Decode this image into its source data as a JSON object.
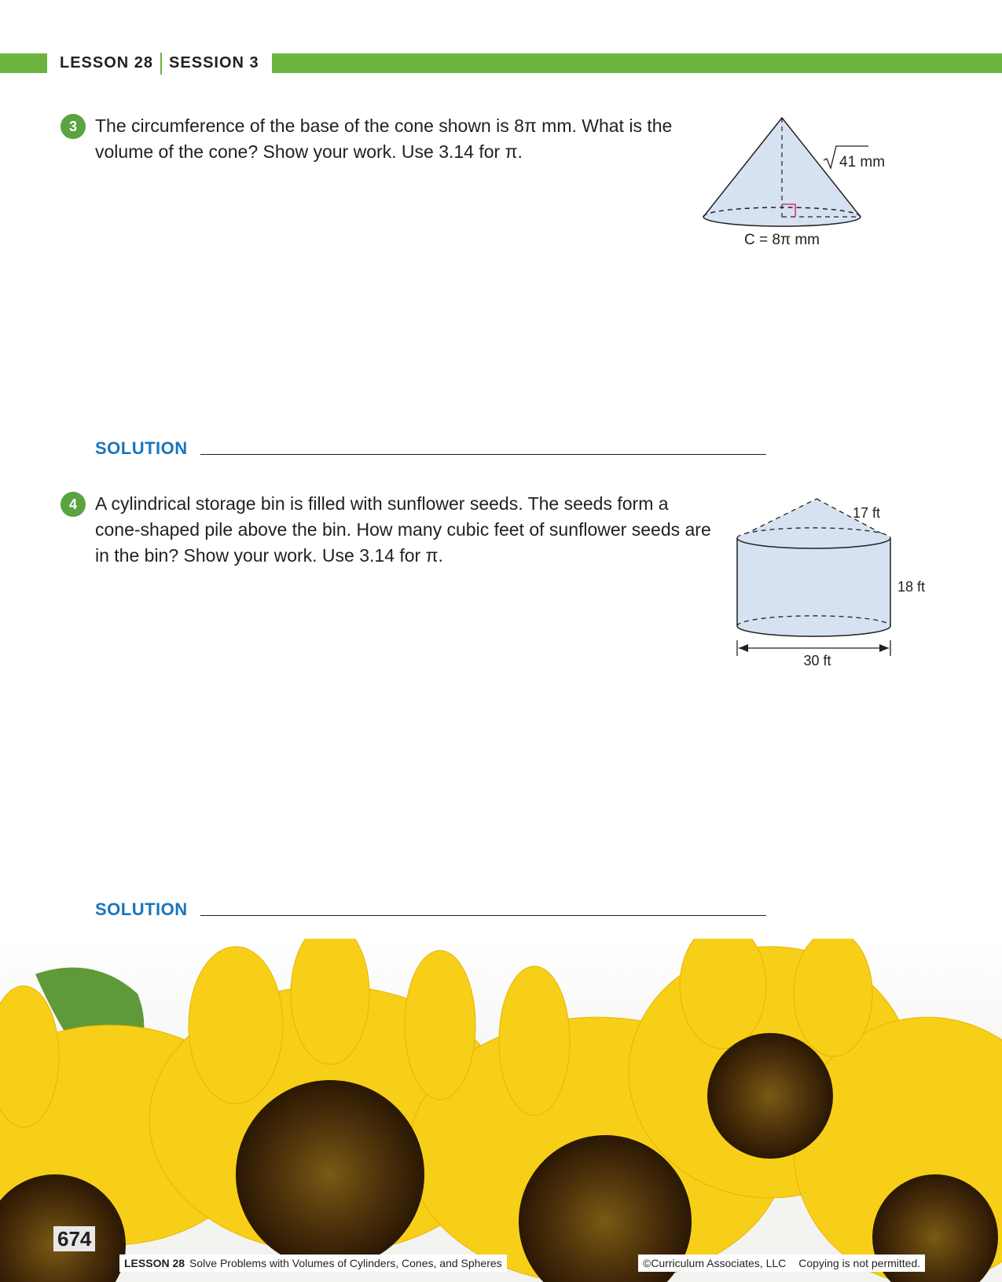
{
  "header": {
    "lesson": "LESSON 28",
    "session": "SESSION 3",
    "accent_color": "#6cb33f"
  },
  "questions": [
    {
      "number": "3",
      "lines": [
        "The circumference of the base of the cone shown is 8π mm. What is the",
        "volume of the cone? Show your work. Use 3.14 for π."
      ],
      "solution_label": "SOLUTION",
      "figure": {
        "slant_label": "41 mm",
        "circumference_label": "C = 8π mm"
      }
    },
    {
      "number": "4",
      "lines": [
        "A cylindrical storage bin is filled with sunflower seeds. The seeds form a",
        "cone-shaped pile above the bin. How many cubic feet of sunflower seeds are",
        "in the bin? Show your work. Use 3.14 for π."
      ],
      "solution_label": "SOLUTION",
      "figure": {
        "slant_label": "17 ft",
        "height_label": "18 ft",
        "diameter_label": "30 ft"
      }
    }
  ],
  "footer": {
    "page_number": "674",
    "lesson_label": "LESSON 28",
    "lesson_title": "Solve Problems with Volumes of Cylinders, Cones, and Spheres",
    "copyright": "©Curriculum Associates, LLC",
    "notice": "Copying is not permitted."
  },
  "colors": {
    "question_badge": "#5aa33f",
    "solution_label": "#1a75bc",
    "figure_fill": "#d6e2f1",
    "right_angle_mark": "#d6338a"
  }
}
